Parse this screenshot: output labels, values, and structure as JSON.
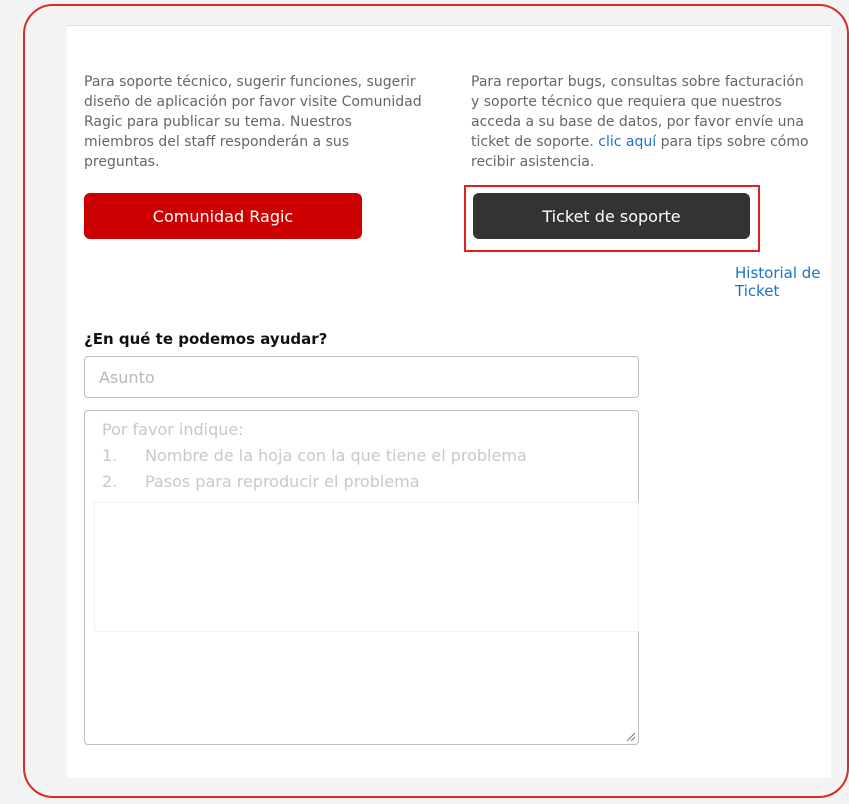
{
  "left_column": {
    "description": "Para soporte técnico, sugerir funciones, sugerir diseño de aplicación por favor visite Comunidad Ragic para publicar su tema. Nuestros miembros del staff responderán a sus preguntas.",
    "button_label": "Comunidad Ragic"
  },
  "right_column": {
    "description": "Para reportar bugs, consultas sobre facturación y soporte técnico que requiera que nuestros acceda a su base de datos, por favor envíe una ticket de soporte.",
    "link_text": "clic aquí",
    "description_after": "para tips sobre cómo recibir asistencia.",
    "button_label": "Ticket de soporte",
    "history_link": "Historial de Ticket"
  },
  "form": {
    "title": "¿En qué te podemos ayudar?",
    "subject_placeholder": "Asunto",
    "message_intro": "Por favor indique:",
    "message_steps": [
      {
        "num": "1.",
        "text": "Nombre de la hoja con la que tiene el problema"
      },
      {
        "num": "2.",
        "text": "Pasos para reproducir el problema"
      }
    ]
  },
  "colors": {
    "community_button": "#cc0000",
    "ticket_button": "#333333",
    "highlight": "#e02020",
    "link": "#1a73c8"
  }
}
